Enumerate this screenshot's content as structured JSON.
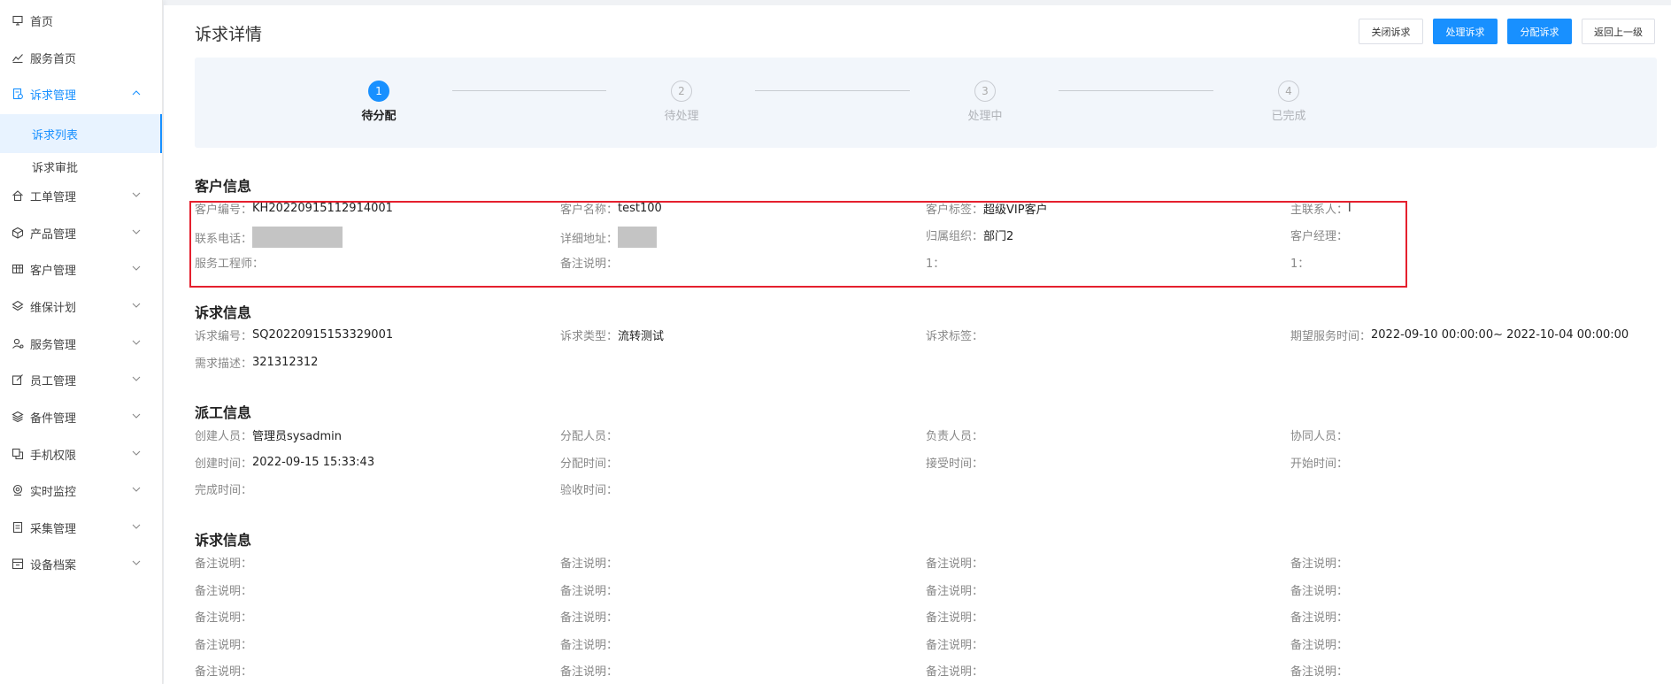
{
  "sidebar": {
    "items": [
      {
        "label": "首页",
        "icon": "monitor-icon"
      },
      {
        "label": "服务首页",
        "icon": "line-chart-icon"
      },
      {
        "label": "诉求管理",
        "icon": "document-icon"
      },
      {
        "label": "工单管理",
        "icon": "home-icon"
      },
      {
        "label": "产品管理",
        "icon": "box-icon"
      },
      {
        "label": "客户管理",
        "icon": "table-icon"
      },
      {
        "label": "维保计划",
        "icon": "layers-icon"
      },
      {
        "label": "服务管理",
        "icon": "user-service-icon"
      },
      {
        "label": "员工管理",
        "icon": "edit-icon"
      },
      {
        "label": "备件管理",
        "icon": "stack-icon"
      },
      {
        "label": "手机权限",
        "icon": "copy-icon"
      },
      {
        "label": "实时监控",
        "icon": "camera-icon"
      },
      {
        "label": "采集管理",
        "icon": "file-icon"
      },
      {
        "label": "设备档案",
        "icon": "archive-icon"
      }
    ],
    "sub_items": [
      {
        "label": "诉求列表"
      },
      {
        "label": "诉求审批"
      }
    ]
  },
  "header": {
    "title": "诉求详情",
    "buttons": {
      "close": "关闭诉求",
      "process": "处理诉求",
      "assign": "分配诉求",
      "back": "返回上一级"
    }
  },
  "steps": [
    {
      "number": "1",
      "label": "待分配",
      "active": true
    },
    {
      "number": "2",
      "label": "待处理",
      "active": false
    },
    {
      "number": "3",
      "label": "处理中",
      "active": false
    },
    {
      "number": "4",
      "label": "已完成",
      "active": false
    }
  ],
  "customer_info": {
    "title": "客户信息",
    "fields": [
      {
        "label": "客户编号：",
        "value": "KH20220915112914001"
      },
      {
        "label": "客户名称：",
        "value": "test100"
      },
      {
        "label": "客户标签：",
        "value": "超级VIP客户"
      },
      {
        "label": "主联系人：",
        "value": "l"
      },
      {
        "label": "联系电话：",
        "value": ""
      },
      {
        "label": "详细地址：",
        "value": ""
      },
      {
        "label": "归属组织：",
        "value": "部门2"
      },
      {
        "label": "客户经理：",
        "value": ""
      },
      {
        "label": "服务工程师：",
        "value": ""
      },
      {
        "label": "备注说明：",
        "value": ""
      },
      {
        "label": "1：",
        "value": ""
      },
      {
        "label": "1：",
        "value": ""
      }
    ]
  },
  "request_info": {
    "title": "诉求信息",
    "fields": [
      {
        "label": "诉求编号：",
        "value": "SQ20220915153329001"
      },
      {
        "label": "诉求类型：",
        "value": "流转测试"
      },
      {
        "label": "诉求标签：",
        "value": ""
      },
      {
        "label": "期望服务时间：",
        "value": "2022-09-10 00:00:00~ 2022-10-04 00:00:00"
      },
      {
        "label": "需求描述：",
        "value": "321312312"
      }
    ]
  },
  "dispatch_info": {
    "title": "派工信息",
    "fields": [
      {
        "label": "创建人员：",
        "value": "管理员sysadmin"
      },
      {
        "label": "分配人员：",
        "value": ""
      },
      {
        "label": "负责人员：",
        "value": ""
      },
      {
        "label": "协同人员：",
        "value": ""
      },
      {
        "label": "创建时间：",
        "value": "2022-09-15 15:33:43"
      },
      {
        "label": "分配时间：",
        "value": ""
      },
      {
        "label": "接受时间：",
        "value": ""
      },
      {
        "label": "开始时间：",
        "value": ""
      },
      {
        "label": "完成时间：",
        "value": ""
      },
      {
        "label": "验收时间：",
        "value": ""
      }
    ]
  },
  "request_info_2": {
    "title": "诉求信息",
    "remark_label": "备注说明："
  },
  "colors": {
    "accent": "#1890ff",
    "highlight": "#e5202e",
    "steps_bg": "#f2f6fb"
  }
}
